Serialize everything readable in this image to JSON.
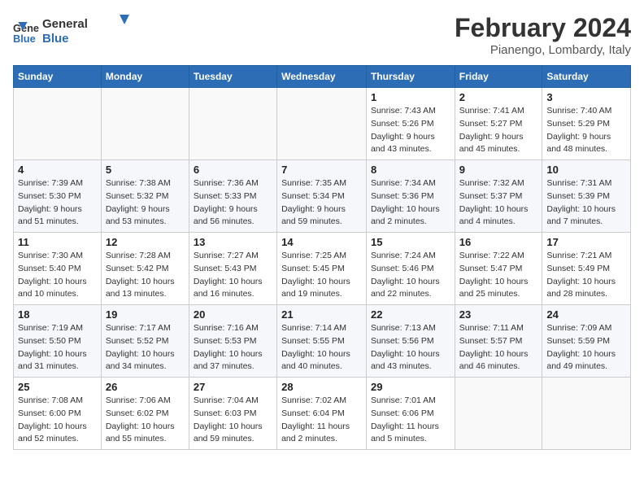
{
  "logo": {
    "line1": "General",
    "line2": "Blue"
  },
  "title": "February 2024",
  "subtitle": "Pianengo, Lombardy, Italy",
  "days_of_week": [
    "Sunday",
    "Monday",
    "Tuesday",
    "Wednesday",
    "Thursday",
    "Friday",
    "Saturday"
  ],
  "weeks": [
    [
      {
        "day": "",
        "info": ""
      },
      {
        "day": "",
        "info": ""
      },
      {
        "day": "",
        "info": ""
      },
      {
        "day": "",
        "info": ""
      },
      {
        "day": "1",
        "info": "Sunrise: 7:43 AM\nSunset: 5:26 PM\nDaylight: 9 hours\nand 43 minutes."
      },
      {
        "day": "2",
        "info": "Sunrise: 7:41 AM\nSunset: 5:27 PM\nDaylight: 9 hours\nand 45 minutes."
      },
      {
        "day": "3",
        "info": "Sunrise: 7:40 AM\nSunset: 5:29 PM\nDaylight: 9 hours\nand 48 minutes."
      }
    ],
    [
      {
        "day": "4",
        "info": "Sunrise: 7:39 AM\nSunset: 5:30 PM\nDaylight: 9 hours\nand 51 minutes."
      },
      {
        "day": "5",
        "info": "Sunrise: 7:38 AM\nSunset: 5:32 PM\nDaylight: 9 hours\nand 53 minutes."
      },
      {
        "day": "6",
        "info": "Sunrise: 7:36 AM\nSunset: 5:33 PM\nDaylight: 9 hours\nand 56 minutes."
      },
      {
        "day": "7",
        "info": "Sunrise: 7:35 AM\nSunset: 5:34 PM\nDaylight: 9 hours\nand 59 minutes."
      },
      {
        "day": "8",
        "info": "Sunrise: 7:34 AM\nSunset: 5:36 PM\nDaylight: 10 hours\nand 2 minutes."
      },
      {
        "day": "9",
        "info": "Sunrise: 7:32 AM\nSunset: 5:37 PM\nDaylight: 10 hours\nand 4 minutes."
      },
      {
        "day": "10",
        "info": "Sunrise: 7:31 AM\nSunset: 5:39 PM\nDaylight: 10 hours\nand 7 minutes."
      }
    ],
    [
      {
        "day": "11",
        "info": "Sunrise: 7:30 AM\nSunset: 5:40 PM\nDaylight: 10 hours\nand 10 minutes."
      },
      {
        "day": "12",
        "info": "Sunrise: 7:28 AM\nSunset: 5:42 PM\nDaylight: 10 hours\nand 13 minutes."
      },
      {
        "day": "13",
        "info": "Sunrise: 7:27 AM\nSunset: 5:43 PM\nDaylight: 10 hours\nand 16 minutes."
      },
      {
        "day": "14",
        "info": "Sunrise: 7:25 AM\nSunset: 5:45 PM\nDaylight: 10 hours\nand 19 minutes."
      },
      {
        "day": "15",
        "info": "Sunrise: 7:24 AM\nSunset: 5:46 PM\nDaylight: 10 hours\nand 22 minutes."
      },
      {
        "day": "16",
        "info": "Sunrise: 7:22 AM\nSunset: 5:47 PM\nDaylight: 10 hours\nand 25 minutes."
      },
      {
        "day": "17",
        "info": "Sunrise: 7:21 AM\nSunset: 5:49 PM\nDaylight: 10 hours\nand 28 minutes."
      }
    ],
    [
      {
        "day": "18",
        "info": "Sunrise: 7:19 AM\nSunset: 5:50 PM\nDaylight: 10 hours\nand 31 minutes."
      },
      {
        "day": "19",
        "info": "Sunrise: 7:17 AM\nSunset: 5:52 PM\nDaylight: 10 hours\nand 34 minutes."
      },
      {
        "day": "20",
        "info": "Sunrise: 7:16 AM\nSunset: 5:53 PM\nDaylight: 10 hours\nand 37 minutes."
      },
      {
        "day": "21",
        "info": "Sunrise: 7:14 AM\nSunset: 5:55 PM\nDaylight: 10 hours\nand 40 minutes."
      },
      {
        "day": "22",
        "info": "Sunrise: 7:13 AM\nSunset: 5:56 PM\nDaylight: 10 hours\nand 43 minutes."
      },
      {
        "day": "23",
        "info": "Sunrise: 7:11 AM\nSunset: 5:57 PM\nDaylight: 10 hours\nand 46 minutes."
      },
      {
        "day": "24",
        "info": "Sunrise: 7:09 AM\nSunset: 5:59 PM\nDaylight: 10 hours\nand 49 minutes."
      }
    ],
    [
      {
        "day": "25",
        "info": "Sunrise: 7:08 AM\nSunset: 6:00 PM\nDaylight: 10 hours\nand 52 minutes."
      },
      {
        "day": "26",
        "info": "Sunrise: 7:06 AM\nSunset: 6:02 PM\nDaylight: 10 hours\nand 55 minutes."
      },
      {
        "day": "27",
        "info": "Sunrise: 7:04 AM\nSunset: 6:03 PM\nDaylight: 10 hours\nand 59 minutes."
      },
      {
        "day": "28",
        "info": "Sunrise: 7:02 AM\nSunset: 6:04 PM\nDaylight: 11 hours\nand 2 minutes."
      },
      {
        "day": "29",
        "info": "Sunrise: 7:01 AM\nSunset: 6:06 PM\nDaylight: 11 hours\nand 5 minutes."
      },
      {
        "day": "",
        "info": ""
      },
      {
        "day": "",
        "info": ""
      }
    ]
  ]
}
